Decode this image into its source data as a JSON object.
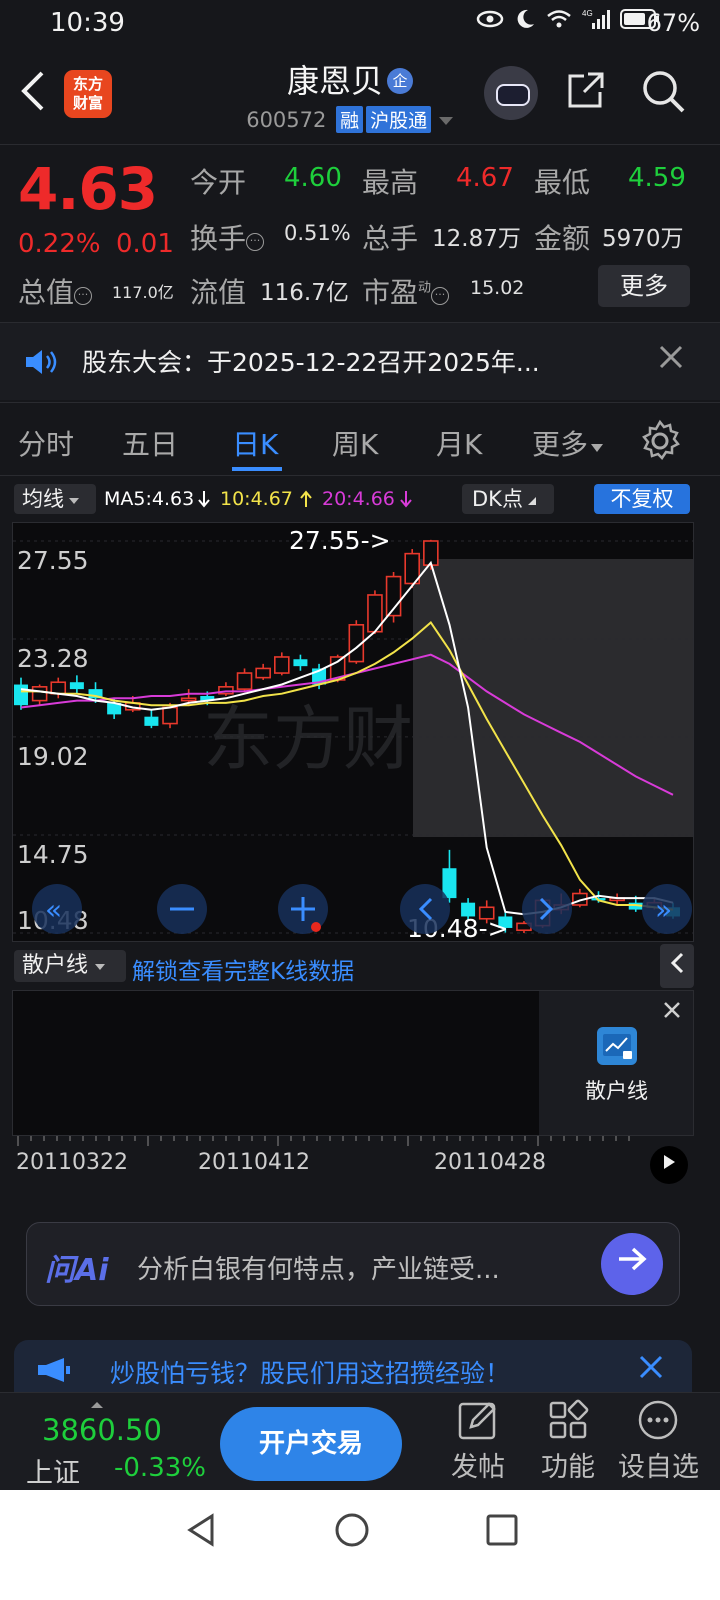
{
  "status_bar": {
    "time": "10:39",
    "battery": "67%"
  },
  "header": {
    "logo_text_1": "东方",
    "logo_text_2": "财富",
    "stock_name": "康恩贝",
    "qi_badge": "企",
    "stock_code": "600572",
    "tags": [
      "融",
      "沪股通"
    ]
  },
  "quote": {
    "price": "4.63",
    "change_pct": "0.22%",
    "change_abs": "0.01",
    "fields": {
      "open_label": "今开",
      "open": "4.60",
      "high_label": "最高",
      "high": "4.67",
      "low_label": "最低",
      "low": "4.59",
      "turnover_label": "换手",
      "turnover": "0.51%",
      "volume_label": "总手",
      "volume": "12.87万",
      "amount_label": "金额",
      "amount": "5970万",
      "mktcap_label": "总值",
      "mktcap": "117.0亿",
      "float_label": "流值",
      "float": "116.7亿",
      "pe_label": "市盈",
      "pe_super": "动",
      "pe": "15.02"
    },
    "more_label": "更多",
    "colors": {
      "up": "#ee2a2a",
      "down": "#1ecf3c"
    }
  },
  "notice": {
    "text": "股东大会：于2025-12-22召开2025年..."
  },
  "tabs": [
    {
      "label": "分时"
    },
    {
      "label": "五日"
    },
    {
      "label": "日K",
      "active": true
    },
    {
      "label": "周K"
    },
    {
      "label": "月K"
    },
    {
      "label": "更多"
    }
  ],
  "indicators": {
    "ma_select": "均线",
    "ma5": "MA5:4.63",
    "ma10": "10:4.67",
    "ma20": "20:4.66",
    "dk": "DK点",
    "adjust": "不复权",
    "colors": {
      "ma5": "#ffffff",
      "ma10": "#f2e34a",
      "ma20": "#d83bd8"
    }
  },
  "chart_data": {
    "type": "candlestick",
    "y_ticks": [
      "27.55",
      "23.28",
      "19.02",
      "14.75",
      "10.48"
    ],
    "ylim": [
      10.48,
      27.55
    ],
    "max_marker": "27.55->",
    "min_marker": "10.48->",
    "watermark": "东方财",
    "candles": [
      {
        "o": 21.3,
        "c": 20.4,
        "h": 21.6,
        "l": 20.2
      },
      {
        "o": 20.6,
        "c": 21.2,
        "h": 21.3,
        "l": 20.4
      },
      {
        "o": 20.9,
        "c": 21.4,
        "h": 21.6,
        "l": 20.7
      },
      {
        "o": 21.4,
        "c": 21.1,
        "h": 21.7,
        "l": 20.9
      },
      {
        "o": 21.1,
        "c": 20.7,
        "h": 21.4,
        "l": 20.5
      },
      {
        "o": 20.5,
        "c": 20.0,
        "h": 20.7,
        "l": 19.8
      },
      {
        "o": 20.2,
        "c": 20.5,
        "h": 20.8,
        "l": 20.1
      },
      {
        "o": 19.9,
        "c": 19.5,
        "h": 20.2,
        "l": 19.4
      },
      {
        "o": 19.6,
        "c": 20.3,
        "h": 20.5,
        "l": 19.4
      },
      {
        "o": 20.6,
        "c": 20.7,
        "h": 21.1,
        "l": 20.4
      },
      {
        "o": 20.8,
        "c": 20.6,
        "h": 21.0,
        "l": 20.4
      },
      {
        "o": 20.9,
        "c": 21.2,
        "h": 21.4,
        "l": 20.8
      },
      {
        "o": 21.1,
        "c": 21.8,
        "h": 22.0,
        "l": 21.0
      },
      {
        "o": 21.6,
        "c": 22.0,
        "h": 22.2,
        "l": 21.5
      },
      {
        "o": 21.8,
        "c": 22.5,
        "h": 22.7,
        "l": 21.7
      },
      {
        "o": 22.4,
        "c": 22.1,
        "h": 22.6,
        "l": 21.9
      },
      {
        "o": 22.0,
        "c": 21.3,
        "h": 22.2,
        "l": 21.1
      },
      {
        "o": 21.5,
        "c": 22.5,
        "h": 22.6,
        "l": 21.4
      },
      {
        "o": 22.3,
        "c": 23.9,
        "h": 24.1,
        "l": 22.2
      },
      {
        "o": 23.6,
        "c": 25.2,
        "h": 25.4,
        "l": 23.5
      },
      {
        "o": 24.3,
        "c": 26.0,
        "h": 26.2,
        "l": 24.0
      },
      {
        "o": 25.7,
        "c": 27.0,
        "h": 27.2,
        "l": 25.5
      },
      {
        "o": 26.5,
        "c": 27.55,
        "h": 27.6,
        "l": 26.3
      },
      {
        "o": 13.3,
        "c": 12.0,
        "h": 14.1,
        "l": 11.8
      },
      {
        "o": 11.8,
        "c": 11.2,
        "h": 12.0,
        "l": 11.0
      },
      {
        "o": 11.1,
        "c": 11.6,
        "h": 11.9,
        "l": 10.9
      },
      {
        "o": 11.2,
        "c": 10.7,
        "h": 11.4,
        "l": 10.5
      },
      {
        "o": 10.6,
        "c": 10.9,
        "h": 11.0,
        "l": 10.48
      },
      {
        "o": 10.8,
        "c": 11.9,
        "h": 12.0,
        "l": 10.7
      },
      {
        "o": 11.5,
        "c": 11.7,
        "h": 12.2,
        "l": 11.3
      },
      {
        "o": 11.7,
        "c": 12.2,
        "h": 12.4,
        "l": 11.6
      },
      {
        "o": 12.0,
        "c": 11.9,
        "h": 12.3,
        "l": 11.8
      },
      {
        "o": 11.9,
        "c": 12.0,
        "h": 12.2,
        "l": 11.7
      },
      {
        "o": 11.8,
        "c": 11.5,
        "h": 12.1,
        "l": 11.4
      },
      {
        "o": 11.6,
        "c": 11.8,
        "h": 12.0,
        "l": 11.5
      },
      {
        "o": 11.6,
        "c": 11.2,
        "h": 11.8,
        "l": 11.1
      }
    ],
    "ma5": [
      21.1,
      21.0,
      20.9,
      20.8,
      20.6,
      20.5,
      20.3,
      20.2,
      20.3,
      20.5,
      20.6,
      20.7,
      20.9,
      21.1,
      21.3,
      21.6,
      21.9,
      22.3,
      22.9,
      23.6,
      24.6,
      25.6,
      26.6,
      23.9,
      20.3,
      14.2,
      11.4,
      11.3,
      11.4,
      11.6,
      11.9,
      12.1,
      12.0,
      12.0,
      12.0,
      11.8
    ],
    "ma10": [
      21.0,
      21.0,
      20.9,
      20.9,
      20.8,
      20.6,
      20.5,
      20.4,
      20.4,
      20.4,
      20.5,
      20.5,
      20.6,
      20.8,
      20.9,
      21.1,
      21.3,
      21.5,
      21.8,
      22.2,
      22.7,
      23.3,
      24.0,
      22.8,
      21.3,
      19.8,
      18.4,
      17.0,
      15.6,
      14.3,
      12.8,
      11.9,
      11.7,
      11.7,
      11.6,
      11.5
    ],
    "ma20": [
      20.3,
      20.4,
      20.5,
      20.6,
      20.6,
      20.7,
      20.7,
      20.8,
      20.8,
      20.9,
      20.9,
      21.0,
      21.0,
      21.1,
      21.2,
      21.3,
      21.4,
      21.6,
      21.8,
      22.0,
      22.2,
      22.4,
      22.6,
      22.2,
      21.6,
      21.0,
      20.5,
      20.0,
      19.6,
      19.2,
      18.8,
      18.3,
      17.8,
      17.3,
      16.9,
      16.5
    ]
  },
  "sub_indicator": {
    "select": "散户线",
    "unlock_text": "解锁查看完整K线数据",
    "panel_label": "散户线"
  },
  "dates": [
    "20110322",
    "20110412",
    "20110428"
  ],
  "ai": {
    "logo": "问Ai",
    "placeholder": "分析白银有何特点，产业链受..."
  },
  "ad": {
    "text": "炒股怕亏钱？股民们用这招攒经验！"
  },
  "bottom": {
    "index_value": "3860.50",
    "index_name": "上证",
    "index_change": "-0.33%",
    "open_account": "开户交易",
    "tools": [
      {
        "label": "发帖"
      },
      {
        "label": "功能"
      },
      {
        "label": "设自选"
      }
    ]
  }
}
